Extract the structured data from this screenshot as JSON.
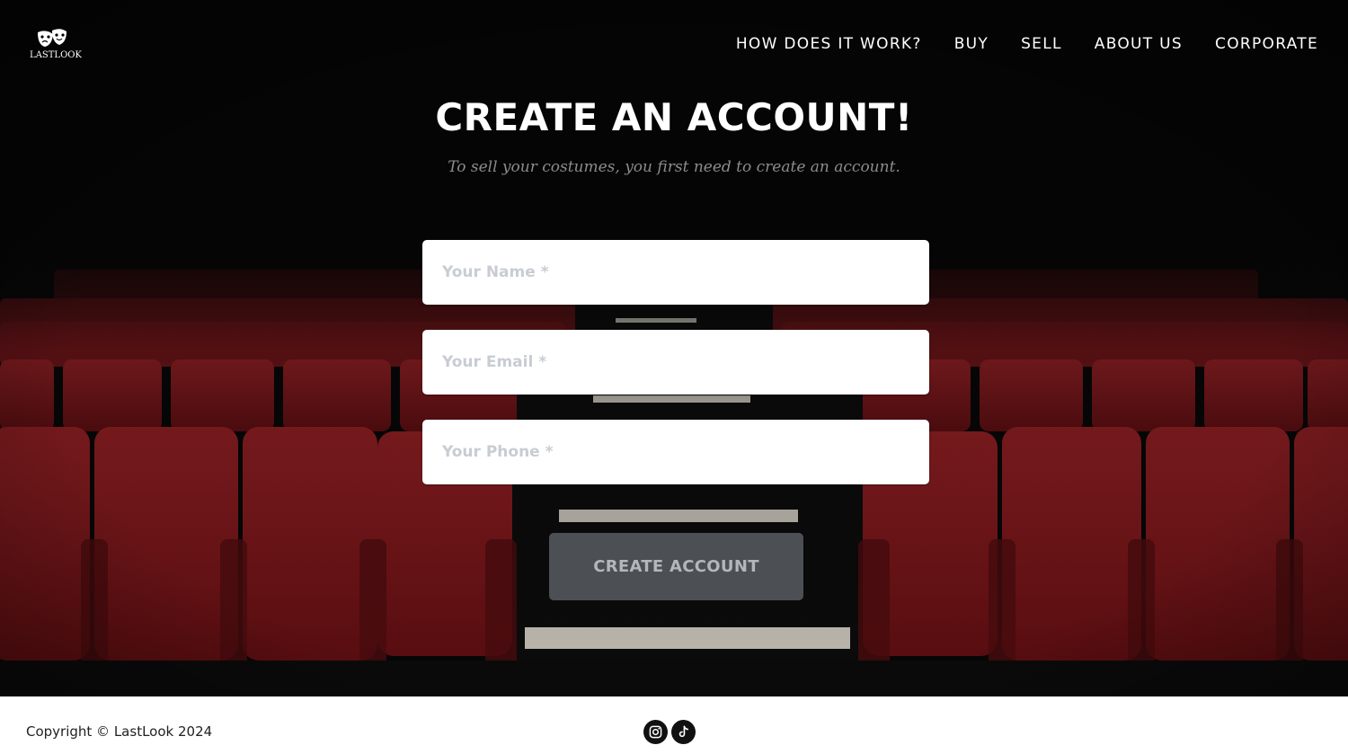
{
  "header": {
    "logo_text": "LASTLOOK",
    "nav": [
      {
        "label": "HOW DOES IT WORK?"
      },
      {
        "label": "BUY"
      },
      {
        "label": "SELL"
      },
      {
        "label": "ABOUT US"
      },
      {
        "label": "CORPORATE"
      }
    ]
  },
  "main": {
    "title": "CREATE AN ACCOUNT!",
    "subtitle": "To sell your costumes, you first need to create an account.",
    "form": {
      "name_placeholder": "Your Name *",
      "email_placeholder": "Your Email *",
      "phone_placeholder": "Your Phone *",
      "submit_label": "CREATE ACCOUNT"
    }
  },
  "footer": {
    "copyright": "Copyright © LastLook 2024",
    "social": [
      {
        "icon": "instagram-icon"
      },
      {
        "icon": "tiktok-icon"
      }
    ]
  },
  "colors": {
    "background_dark": "#050505",
    "seat_red": "#7a1418",
    "button_gray": "#585c62"
  }
}
